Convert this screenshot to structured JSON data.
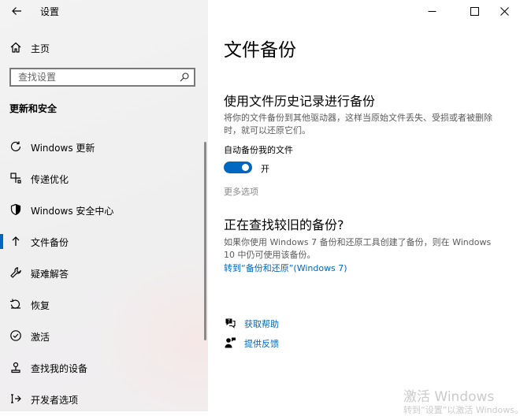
{
  "window": {
    "title": "设置",
    "controls": [
      "minimize",
      "maximize",
      "close"
    ]
  },
  "sidebar": {
    "home_label": "主页",
    "search_placeholder": "查找设置",
    "section_title": "更新和安全",
    "items": [
      {
        "label": "Windows 更新",
        "icon": "refresh-icon",
        "active": false
      },
      {
        "label": "传递优化",
        "icon": "delivery-optimization-icon",
        "active": false
      },
      {
        "label": "Windows 安全中心",
        "icon": "shield-icon",
        "active": false
      },
      {
        "label": "文件备份",
        "icon": "backup-arrow-icon",
        "active": true
      },
      {
        "label": "疑难解答",
        "icon": "wrench-icon",
        "active": false
      },
      {
        "label": "恢复",
        "icon": "recovery-icon",
        "active": false
      },
      {
        "label": "激活",
        "icon": "activation-check-icon",
        "active": false
      },
      {
        "label": "查找我的设备",
        "icon": "find-device-icon",
        "active": false
      },
      {
        "label": "开发者选项",
        "icon": "developer-icon",
        "active": false
      }
    ]
  },
  "main": {
    "page_title": "文件备份",
    "history_section": {
      "heading": "使用文件历史记录进行备份",
      "description": "将你的文件备份到其他驱动器，这样当原始文件丢失、受损或者被删除时，就可以还原它们。",
      "toggle_label": "自动备份我的文件",
      "toggle_state": "开",
      "toggle_on": true,
      "more_options": "更多选项"
    },
    "older_backup_section": {
      "heading": "正在查找较旧的备份?",
      "description": "如果你使用 Windows 7 备份和还原工具创建了备份，则在 Windows 10 中仍可使用该备份。",
      "link": "转到“备份和还原”(Windows 7)"
    },
    "help_links": [
      {
        "label": "获取帮助",
        "icon": "help-chat-icon"
      },
      {
        "label": "提供反馈",
        "icon": "feedback-icon"
      }
    ]
  },
  "watermark": {
    "line1": "激活 Windows",
    "line2": "转到“设置”以激活 Windows。"
  },
  "colors": {
    "accent": "#0067c0",
    "sidebar_bg": "#f3f3f3",
    "secondary_text": "#5b5b5b",
    "disabled_text": "#8a8a8a"
  }
}
